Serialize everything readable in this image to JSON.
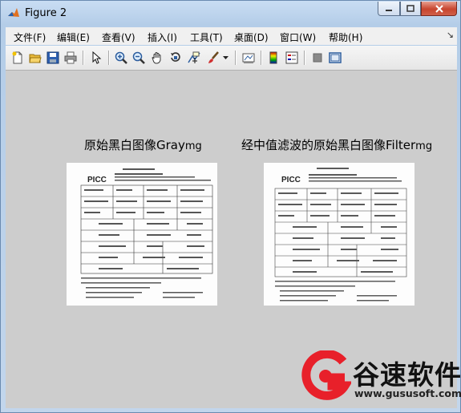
{
  "window": {
    "title": "Figure 2"
  },
  "menu": [
    "文件(F)",
    "编辑(E)",
    "查看(V)",
    "插入(I)",
    "工具(T)",
    "桌面(D)",
    "窗口(W)",
    "帮助(H)"
  ],
  "toolbar_icons": [
    "new-figure-icon",
    "open-file-icon",
    "save-icon",
    "print-icon",
    "select-arrow-icon",
    "zoom-in-icon",
    "zoom-out-icon",
    "pan-hand-icon",
    "rotate-3d-icon",
    "data-cursor-icon",
    "brush-icon",
    "dropdown-arrow-icon",
    "link-plot-icon",
    "colorbar-icon",
    "legend-icon",
    "hide-plot-tools-icon",
    "show-plot-tools-icon"
  ],
  "plots": [
    {
      "title": "原始黑白图像Gray",
      "title_suffix": "mg",
      "header_text": "PICC"
    },
    {
      "title": "经中值滤波的原始黑白图像Filter",
      "title_suffix": "mg",
      "header_text": "PICC"
    }
  ],
  "watermark": {
    "text": "谷速软件",
    "url": "www.gususoft.com",
    "color": "#e8202a"
  }
}
